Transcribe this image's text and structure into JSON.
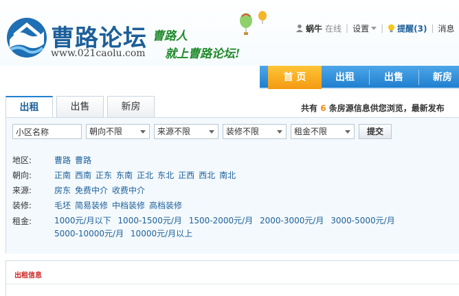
{
  "site": {
    "logo_text": "曹路论坛",
    "url": "www.021caolu.com",
    "slogan_line1": "曹路人",
    "slogan_line2": "就上曹路论坛!"
  },
  "userbar": {
    "username": "蜗牛",
    "status": "在线",
    "settings": "设置",
    "alerts": "提醒(3)",
    "messages": "消息"
  },
  "nav": {
    "items": [
      "首 页",
      "出租",
      "出售",
      "新房"
    ],
    "active": "首 页"
  },
  "tabs": [
    "出租",
    "出售",
    "新房"
  ],
  "summary": {
    "prefix": "共有",
    "count": "6",
    "suffix": "条房源信息供您浏览，最新发布"
  },
  "search": {
    "community_value": "小区名称",
    "orientation": "朝向不限",
    "source": "来源不限",
    "decoration": "装修不限",
    "rent": "租金不限",
    "submit": "提交"
  },
  "filters": {
    "region": {
      "label": "地区:",
      "options": [
        "曹路",
        "曹路"
      ]
    },
    "orientation": {
      "label": "朝向:",
      "options": [
        "正南",
        "西南",
        "正东",
        "东南",
        "正北",
        "东北",
        "正西",
        "西北",
        "南北"
      ]
    },
    "source": {
      "label": "来源:",
      "options": [
        "房东",
        "免费中介",
        "收费中介"
      ]
    },
    "decoration": {
      "label": "装修:",
      "options": [
        "毛坯",
        "简易装修",
        "中档装修",
        "高档装修"
      ]
    },
    "rent": {
      "label": "租金:",
      "options": [
        "1000元/月以下",
        "1000-1500元/月",
        "1500-2000元/月",
        "2000-3000元/月",
        "3000-5000元/月",
        "5000-10000元/月",
        "10000元/月以上"
      ]
    }
  },
  "listing": {
    "title": "出租信息"
  },
  "colors": {
    "brand_blue": "#1d5f99",
    "nav_active": "#f39a11",
    "highlight": "#f08c1a",
    "section_red": "#cc2222"
  }
}
